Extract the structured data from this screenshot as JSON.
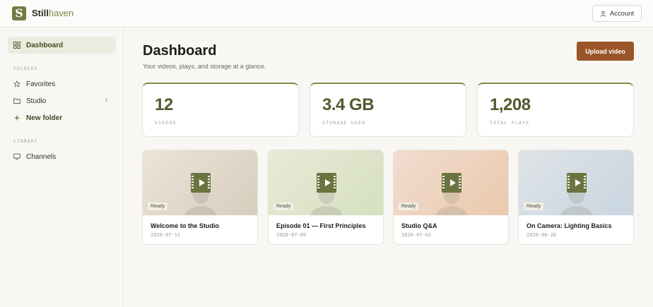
{
  "header": {
    "logo_letter": "S",
    "brand_first": "Still",
    "brand_second": "haven",
    "account_label": "Account"
  },
  "sidebar": {
    "dashboard": "Dashboard",
    "folders_label": "FOLDERS",
    "favorites": "Favorites",
    "studio": "Studio",
    "new_folder": "New folder",
    "library_label": "LIBRARY",
    "channels": "Channels"
  },
  "main": {
    "title": "Dashboard",
    "subtitle": "Your videos, plays, and storage at a glance.",
    "upload_label": "Upload video"
  },
  "stats": [
    {
      "value": "12",
      "label": "VIDEOS"
    },
    {
      "value": "3.4 GB",
      "label": "STORAGE USED"
    },
    {
      "value": "1,208",
      "label": "TOTAL PLAYS"
    }
  ],
  "videos": [
    {
      "title": "Welcome to the Studio",
      "date": "2026-07-11",
      "status": "Ready",
      "thumb_from": "#ebe4d9",
      "thumb_to": "#d8cdbd"
    },
    {
      "title": "Episode 01 — First Principles",
      "date": "2026-07-09",
      "status": "Ready",
      "thumb_from": "#e7ebd8",
      "thumb_to": "#d6dfbf"
    },
    {
      "title": "Studio Q&A",
      "date": "2026-07-02",
      "status": "Ready",
      "thumb_from": "#f1ddd0",
      "thumb_to": "#ebc9ad"
    },
    {
      "title": "On Camera: Lighting Basics",
      "date": "2026-06-28",
      "status": "Ready",
      "thumb_from": "#dfe4e7",
      "thumb_to": "#c8d5e0"
    }
  ],
  "colors": {
    "accent": "#7d8c47",
    "upload_button": "#9a562a",
    "play_icon": "#6b7440"
  }
}
